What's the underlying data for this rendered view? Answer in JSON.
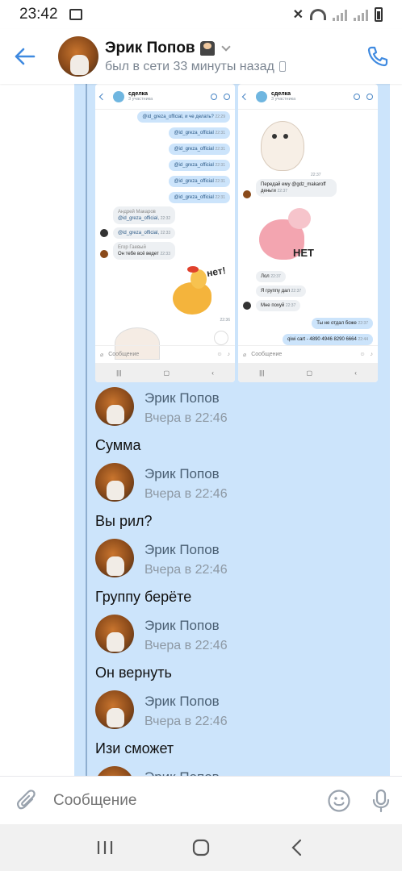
{
  "status_bar": {
    "time": "23:42"
  },
  "header": {
    "name": "Эрик Попов",
    "status": "был в сети 33 минуты назад"
  },
  "shots": {
    "left": {
      "title": "сделка",
      "subtitle": "3 участника",
      "bubbles": [
        {
          "text": "@id_greza_official, и че делать?",
          "time": "22:29"
        },
        {
          "text": "@id_greza_official",
          "time": "22:31"
        },
        {
          "text": "@id_greza_official",
          "time": "22:31"
        },
        {
          "text": "@id_greza_official",
          "time": "22:31"
        },
        {
          "text": "@id_greza_official",
          "time": "22:31"
        },
        {
          "text": "@id_greza_official",
          "time": "22:31"
        }
      ],
      "in1_author": "Андрей Макаров",
      "in1_text": "@id_greza_official,",
      "in1_time": "22:32",
      "in2_text": "@id_greza_official,",
      "in2_time": "22:33",
      "in3_author": "Егор Гаевый",
      "in3_text": "Он тебе всё ведет",
      "in3_time": "22:33",
      "sticker_text": "нет!",
      "sticker_time": "22:36",
      "input": "Сообщение"
    },
    "right": {
      "title": "сделка",
      "subtitle": "3 участника",
      "in1_text": "Передай ему @gdz_makaroff деньги",
      "in1_time": "22:37",
      "sticker_text": "НЕТ",
      "in2_text": "Лол",
      "in2_time": "22:37",
      "in3_text": "Я группу дал",
      "in3_time": "22:37",
      "in4_text": "Мне похуй",
      "in4_time": "22:37",
      "out1_text": "Ты не отдал боже",
      "out1_time": "22:37",
      "out2_text": "qiwi cart - 4890 4946 8290 6664",
      "out2_time": "22:44",
      "input": "Сообщение"
    }
  },
  "messages": [
    {
      "name": "Эрик Попов",
      "time": "Вчера в 22:46",
      "text": "Сумма"
    },
    {
      "name": "Эрик Попов",
      "time": "Вчера в 22:46",
      "text": "Вы рил?"
    },
    {
      "name": "Эрик Попов",
      "time": "Вчера в 22:46",
      "text": "Группу берёте"
    },
    {
      "name": "Эрик Попов",
      "time": "Вчера в 22:46",
      "text": "Он вернуть"
    },
    {
      "name": "Эрик Попов",
      "time": "Вчера в 22:46",
      "text": "Изи сможет"
    },
    {
      "name": "Эрик Попов",
      "time": "",
      "text": ""
    }
  ],
  "input": {
    "placeholder": "Сообщение"
  },
  "colors": {
    "accent": "#3f8ae0",
    "selection": "#cce4fb"
  }
}
